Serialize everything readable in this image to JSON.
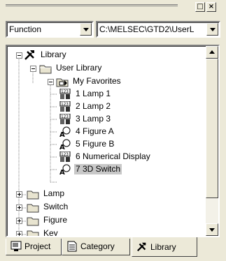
{
  "toolbar": {
    "dock_label": "□",
    "close_label": "×",
    "category_select": "Function",
    "path_select": "C:\\MELSEC\\GTD2\\UserL"
  },
  "tree": {
    "root": "Library",
    "user_library": "User Library",
    "favorites": "My Favorites",
    "items": [
      {
        "label": "1 Lamp 1",
        "icon": "lamp-part-icon"
      },
      {
        "label": "2 Lamp 2",
        "icon": "lamp-part-icon"
      },
      {
        "label": "3 Lamp 3",
        "icon": "lamp-part-icon"
      },
      {
        "label": "4 Figure A",
        "icon": "figure-part-icon"
      },
      {
        "label": "5 Figure B",
        "icon": "figure-part-icon"
      },
      {
        "label": "6 Numerical Display",
        "icon": "numeric-part-icon"
      },
      {
        "label": "7 3D Switch",
        "icon": "figure-part-icon",
        "selected": true
      }
    ],
    "folders": [
      "Lamp",
      "Switch",
      "Figure",
      "Key"
    ]
  },
  "tabs": [
    {
      "label": "Project",
      "icon": "project-icon"
    },
    {
      "label": "Category",
      "icon": "category-icon"
    },
    {
      "label": "Library",
      "icon": "library-tools-icon",
      "active": true
    }
  ]
}
